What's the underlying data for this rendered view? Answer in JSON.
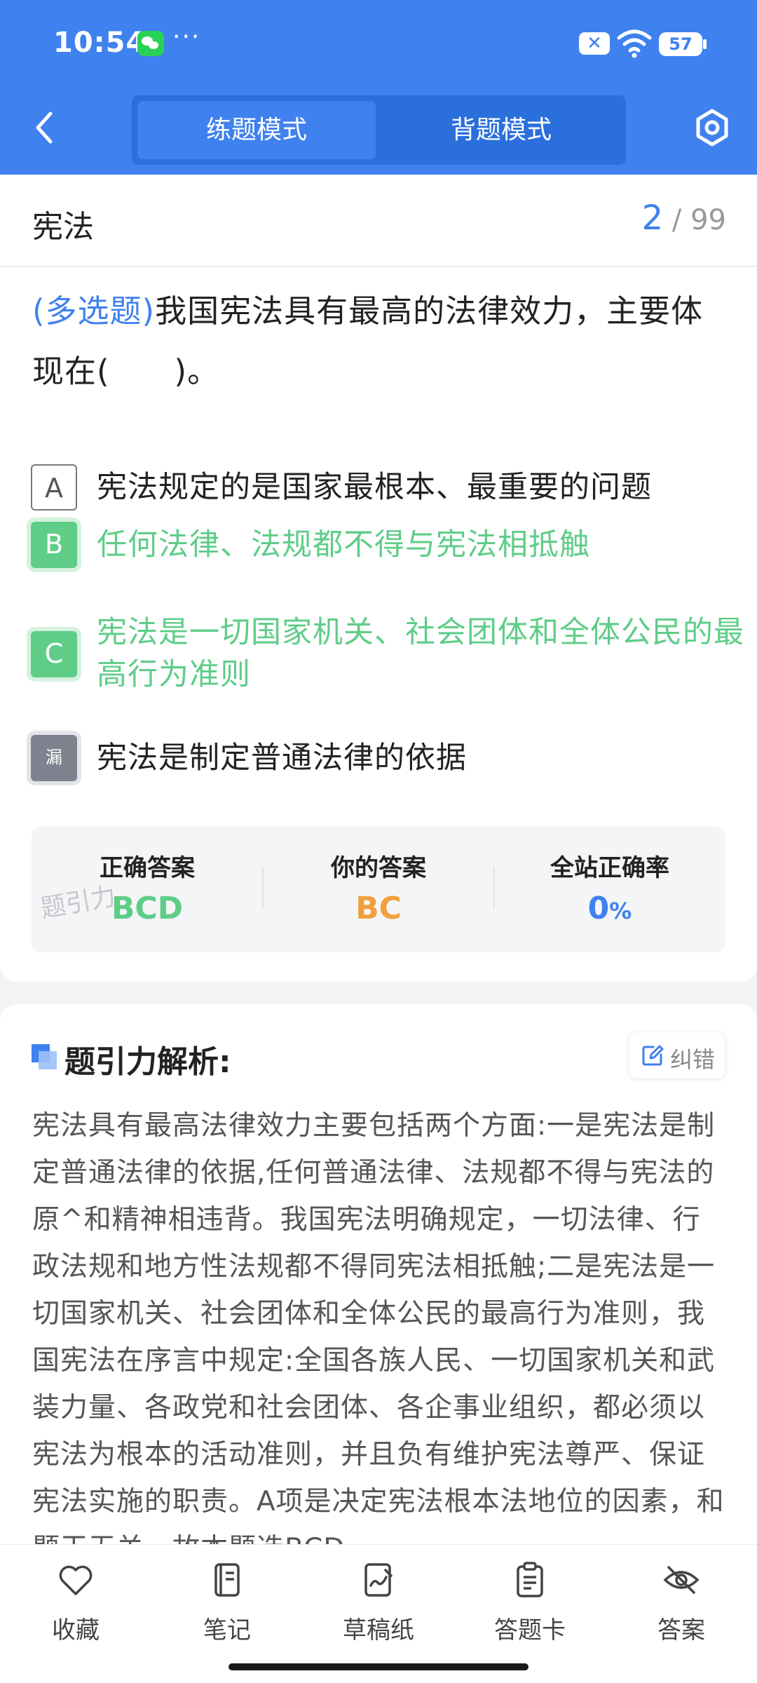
{
  "status_bar": {
    "time": "10:54",
    "more": "···",
    "battery": "57"
  },
  "header": {
    "tabs": [
      {
        "label": "练题模式",
        "active": true
      },
      {
        "label": "背题模式",
        "active": false
      }
    ]
  },
  "question": {
    "subject": "宪法",
    "current": "2",
    "total": "/ 99",
    "type": "(多选题)",
    "text": "我国宪法具有最高的法律效力，主要体现在(　　)。",
    "options": [
      {
        "badge": "A",
        "state": "default",
        "text": "宪法规定的是国家最根本、最重要的问题"
      },
      {
        "badge": "B",
        "state": "correct",
        "text": "任何法律、法规都不得与宪法相抵触"
      },
      {
        "badge": "C",
        "state": "correct",
        "text": "宪法是一切国家机关、社会团体和全体公民的最高行为准则"
      },
      {
        "badge": "漏",
        "state": "missed",
        "text": "宪法是制定普通法律的依据"
      }
    ]
  },
  "answer_summary": {
    "correct_label": "正确答案",
    "correct_value": "BCD",
    "yours_label": "你的答案",
    "yours_value": "BC",
    "rate_label": "全站正确率",
    "rate_value": "0",
    "rate_unit": "%",
    "watermark": "题引力",
    "colors": {
      "correct": "#5fcd88",
      "yours": "#f0a03c",
      "rate": "#3f81ee"
    }
  },
  "analysis": {
    "title": "题引力解析:",
    "report_label": "纠错",
    "text": "宪法具有最高法律效力主要包括两个方面:一是宪法是制定普通法律的依据,任何普通法律、法规都不得与宪法的原^和精神相违背。我国宪法明确规定，一切法律、行政法规和地方性法规都不得同宪法相抵触;二是宪法是一切国家机关、社会团体和全体公民的最高行为准则，我国宪法在序言中规定:全国各族人民、一切国家机关和武装力量、各政党和社会团体、各企事业组织，都必须以宪法为根本的活动准则，并且负有维护宪法尊严、保证宪法实施的职责。A项是决定宪法根本法地位的因素，和题干无关。故本题选BCD。"
  },
  "bottom_nav": [
    {
      "label": "收藏",
      "icon": "heart-icon"
    },
    {
      "label": "笔记",
      "icon": "notebook-icon"
    },
    {
      "label": "草稿纸",
      "icon": "draft-paper-icon"
    },
    {
      "label": "答题卡",
      "icon": "answer-sheet-icon"
    },
    {
      "label": "答案",
      "icon": "eye-off-icon"
    }
  ],
  "theme": {
    "primary": "#3f81ee",
    "success": "#5fcd88"
  }
}
